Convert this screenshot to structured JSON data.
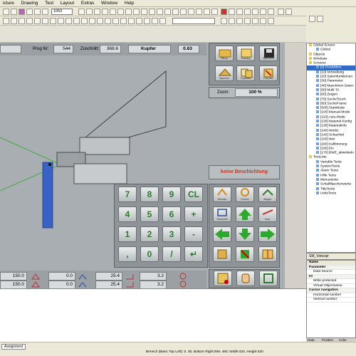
{
  "menubar": [
    "icture",
    "Drawing",
    "Test",
    "Layout",
    "Extras",
    "Window",
    "Help"
  ],
  "toolbar": {
    "zoom_select": "1053"
  },
  "top_fields": {
    "left_value": "",
    "prog_label": "Prog Nr:",
    "prog_value": "544",
    "zuschnitt_label": "Zuschnitt:",
    "zuschnitt_value": "368.6",
    "material": "Kupfer",
    "thickness": "0.63"
  },
  "zoom": {
    "label": "Zoom:",
    "value": "100 %"
  },
  "top_buttons": [
    {
      "name": "open",
      "label": "Öffnen"
    },
    {
      "name": "drawing",
      "label": "Drawing"
    },
    {
      "name": "save",
      "label": "Speichern"
    },
    {
      "name": "spannen",
      "label": "Spannen"
    },
    {
      "name": "kopieren",
      "label": "Kopieren"
    },
    {
      "name": "loeschen",
      "label": "Löschen"
    }
  ],
  "banner": "keine Beschichtung",
  "keypad": [
    [
      "7",
      "8",
      "9",
      "CL"
    ],
    [
      "4",
      "5",
      "6",
      "+"
    ],
    [
      "1",
      "2",
      "3",
      "-"
    ],
    [
      ",",
      "0",
      "/",
      "↵"
    ]
  ],
  "side_buttons": [
    {
      "name": "wenden",
      "label": "Wenden"
    },
    {
      "name": "drehen",
      "label": "Drehen"
    },
    {
      "name": "biegen",
      "label": "Biegen"
    },
    {
      "name": "schachtel",
      "label": "Schachtel"
    },
    {
      "name": "pfeil-hoch",
      "label": ""
    },
    {
      "name": "ausr",
      "label": "Ausr."
    },
    {
      "name": "pfeil-links",
      "label": ""
    },
    {
      "name": "pfeil-runter",
      "label": ""
    },
    {
      "name": "pfeil-rechts",
      "label": ""
    },
    {
      "name": "werkzeug",
      "label": ""
    },
    {
      "name": "abbruch",
      "label": ""
    },
    {
      "name": "muster",
      "label": ""
    }
  ],
  "bottom_values": {
    "row1": [
      "150.0",
      "0.0",
      "25.4",
      "3.2"
    ],
    "row2": [
      "150.0",
      "0.0",
      "25.4",
      "3.2"
    ]
  },
  "tree": {
    "items": [
      {
        "label": "Global Screen",
        "level": 0
      },
      {
        "label": "Global",
        "level": 1
      },
      {
        "label": "Objects",
        "level": 0
      },
      {
        "label": "Windows",
        "level": 0
      },
      {
        "label": "Screens",
        "level": 0
      },
      {
        "label": "[0] Produktion",
        "level": 1,
        "selected": true
      },
      {
        "label": "[10] Verwaltung",
        "level": 1
      },
      {
        "label": "[20] Sytemfunktionen",
        "level": 1
      },
      {
        "label": "[30] Parameter",
        "level": 1
      },
      {
        "label": "[40] Maschinen Daten",
        "level": 1
      },
      {
        "label": "[50] Multi TA",
        "level": 1
      },
      {
        "label": "[60] Zeigen",
        "level": 1
      },
      {
        "label": "[70] SucheTouch",
        "level": 1
      },
      {
        "label": "[80] SucheFrame",
        "level": 1
      },
      {
        "label": "[500] StartMode",
        "level": 1
      },
      {
        "label": "[100] Manual-Mode",
        "level": 1
      },
      {
        "label": "[110] Auto-Mode",
        "level": 1
      },
      {
        "label": "[130] Material Konfig",
        "level": 1
      },
      {
        "label": "[135] Materialinfo",
        "level": 1
      },
      {
        "label": "[140] Werkz",
        "level": 1
      },
      {
        "label": "[145] Schachtel",
        "level": 1
      },
      {
        "label": "[150] Wer",
        "level": 1
      },
      {
        "label": "[160] Kalibrierung",
        "level": 1
      },
      {
        "label": "[165] Ein",
        "level": 1
      },
      {
        "label": "[170] BWE_abwinkeln",
        "level": 1
      },
      {
        "label": "TextLists",
        "level": 0
      },
      {
        "label": "Variable Texts",
        "level": 1
      },
      {
        "label": "SystemTexts",
        "level": 1
      },
      {
        "label": "Alarm Texts",
        "level": 1
      },
      {
        "label": "Hilfe Texts",
        "level": 1
      },
      {
        "label": "Menuetexte",
        "level": 1
      },
      {
        "label": "Schaltflaechenwerte",
        "level": 1
      },
      {
        "label": "TitleTexts",
        "level": 1
      },
      {
        "label": "UnitsTexts",
        "level": 1
      }
    ],
    "tab": "SM_View.tpr"
  },
  "props": {
    "header": "Name",
    "rows": [
      {
        "label": "Parameter",
        "group": true
      },
      {
        "label": "Data Source",
        "group": false
      },
      {
        "label": "IO",
        "group": true
      },
      {
        "label": "Write protected",
        "group": false
      },
      {
        "label": "Virtual Objectname",
        "group": false
      },
      {
        "label": "Cursor navigation",
        "group": true
      },
      {
        "label": "Horizontal number",
        "group": false
      },
      {
        "label": "Vertical number",
        "group": false
      }
    ],
    "tabs": [
      "Data",
      "Position",
      "Color"
    ]
  },
  "statusbar": {
    "tab": "Assignment",
    "text": "Bereich (Basic Top Left): 0, 30, Bottom Right:509, 460;  Width:420, Height:420"
  },
  "colors": {
    "banner": "#c0392b",
    "keypad_text": "#2e7a30",
    "work_blue": "#3a62c4"
  }
}
